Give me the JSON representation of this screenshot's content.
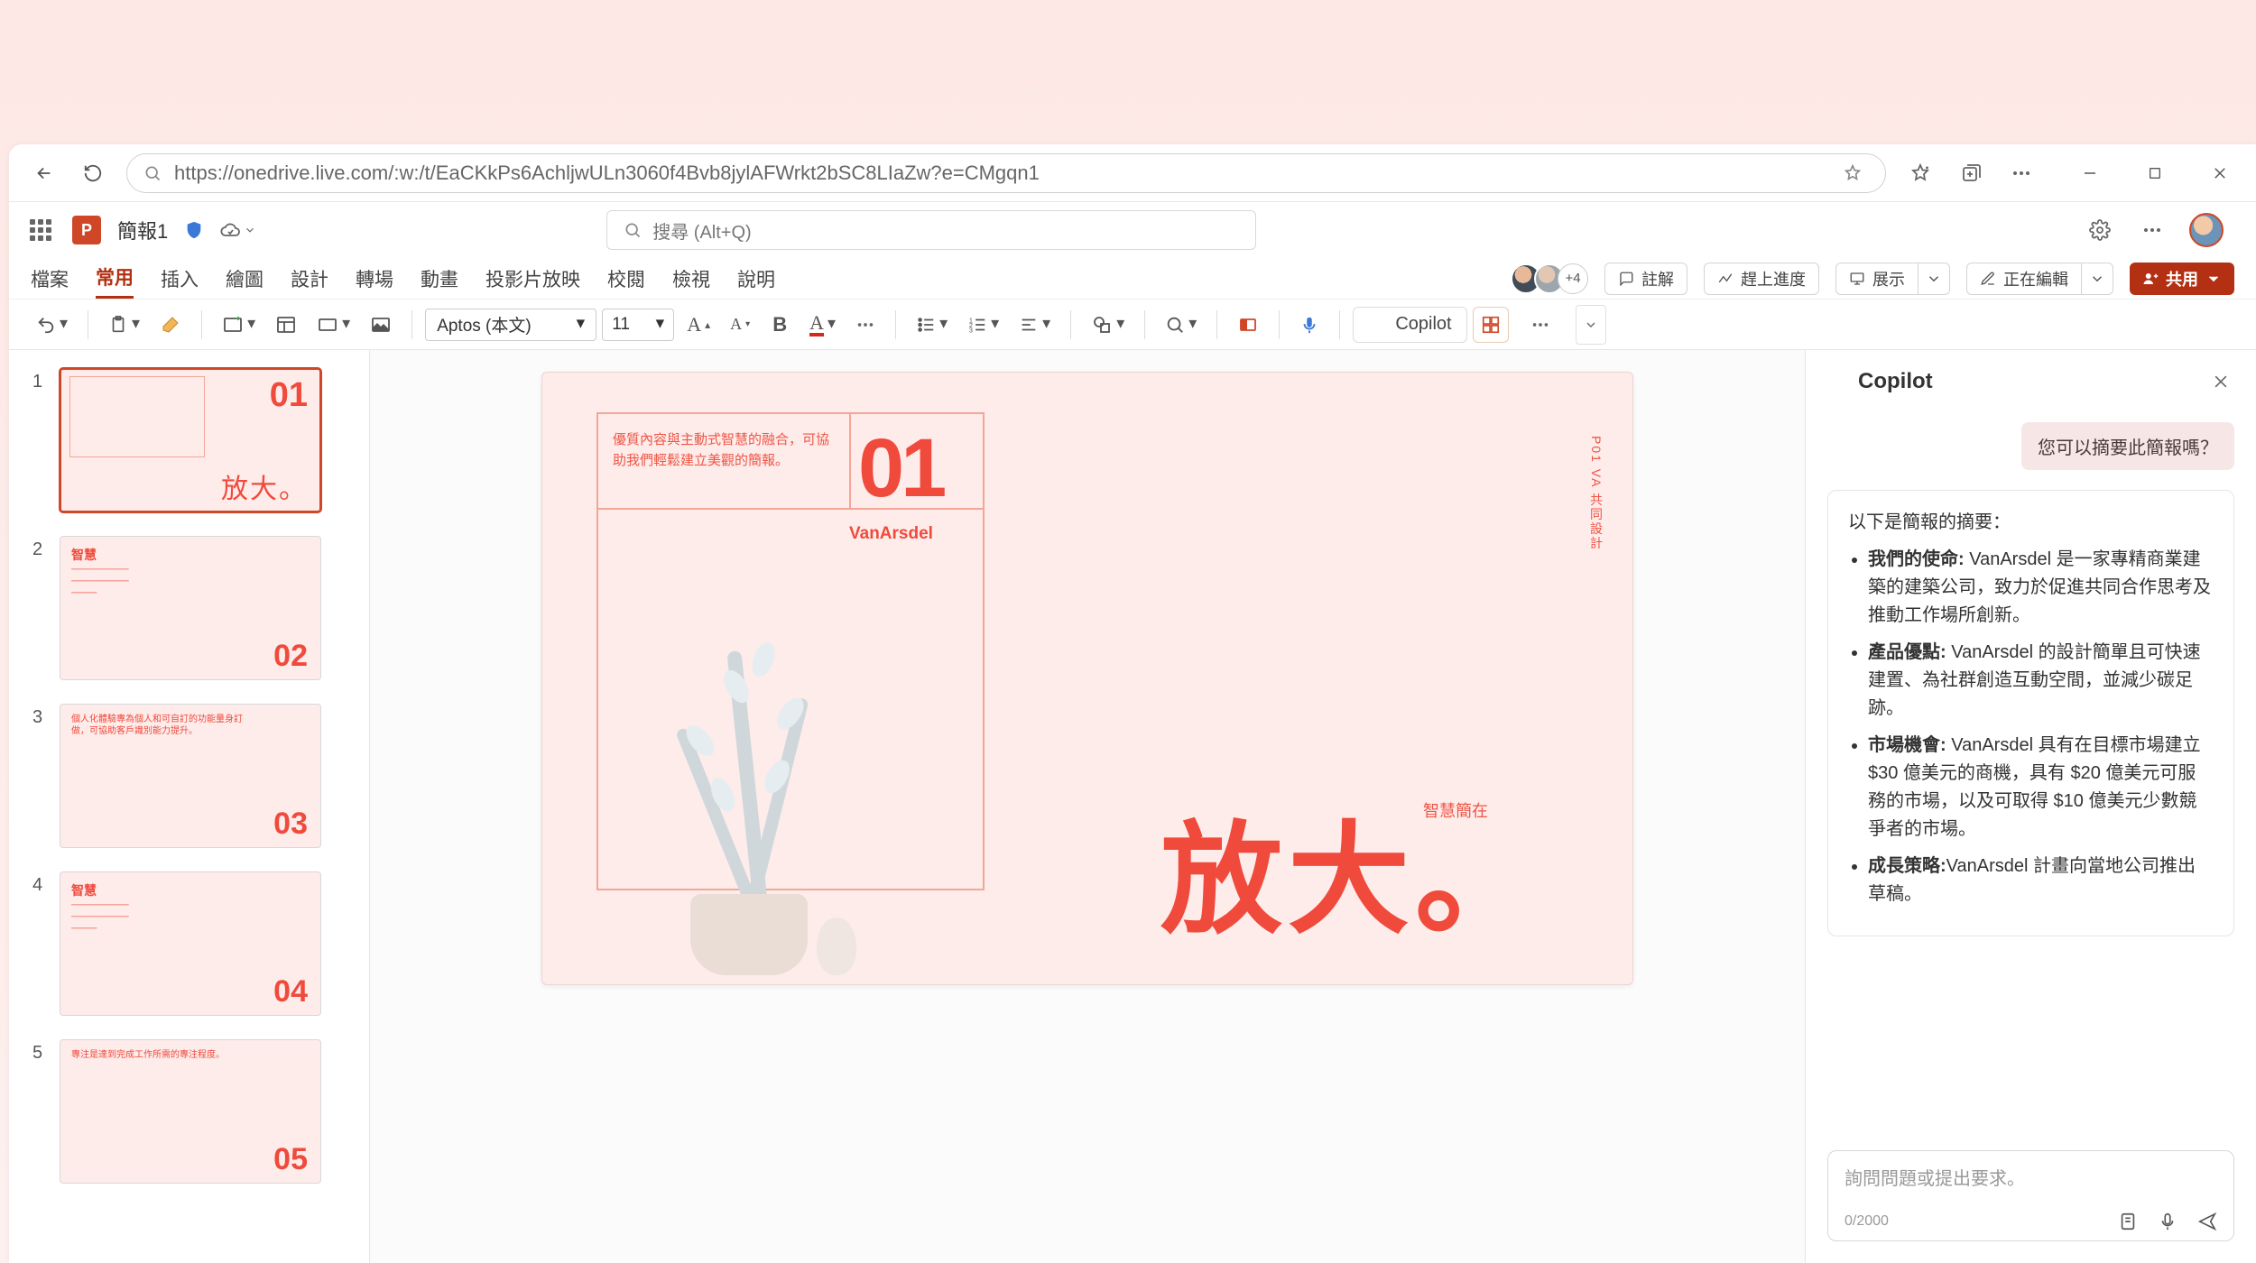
{
  "browser": {
    "url": "https://onedrive.live.com/:w:/t/EaCKkPs6AchljwULn3060f4Bvb8jylAFWrkt2bSC8LIaZw?e=CMgqn1"
  },
  "titlebar": {
    "doc_name": "簡報1",
    "search_placeholder": "搜尋 (Alt+Q)"
  },
  "tabs": {
    "file": "檔案",
    "home": "常用",
    "insert": "插入",
    "draw": "繪圖",
    "design": "設計",
    "transitions": "轉場",
    "animations": "動畫",
    "slideshow": "投影片放映",
    "review": "校閱",
    "view": "檢視",
    "help": "說明",
    "collab_extra": "+4",
    "comments": "註解",
    "catchup": "趕上進度",
    "present": "展示",
    "editing": "正在編輯",
    "share": "共用"
  },
  "toolbar": {
    "font_name": "Aptos (本文)",
    "font_size": "11",
    "copilot_label": "Copilot"
  },
  "slide": {
    "desc": "優質內容與主動式智慧的融合，可協助我們輕鬆建立美觀的簡報。",
    "bignum": "01",
    "brand": "VanArsdel",
    "supertitle": "智慧簡在",
    "mega": "放大。",
    "side": "P01   VA 共同設計"
  },
  "thumbs": [
    {
      "num": "1",
      "corner": "01",
      "big": "放大。"
    },
    {
      "num": "2",
      "head": "智慧",
      "corner": "02"
    },
    {
      "num": "3",
      "head": "個人化體驗專為個人和可自訂的功能量身訂做，可協助客戶識別能力提升。",
      "corner": "03"
    },
    {
      "num": "4",
      "head": "智慧",
      "corner": "04"
    },
    {
      "num": "5",
      "head": "專注是達到完成工作所需的專注程度。",
      "corner": "05"
    }
  ],
  "copilot": {
    "title": "Copilot",
    "user_msg": "您可以摘要此簡報嗎？",
    "ai_intro": "以下是簡報的摘要：",
    "bullets": [
      {
        "b": "我們的使命:",
        "t": " VanArsdel 是一家專精商業建築的建築公司，致力於促進共同合作思考及推動工作場所創新。"
      },
      {
        "b": "產品優點:",
        "t": " VanArsdel 的設計簡單且可快速建置、為社群創造互動空間，並減少碳足跡。"
      },
      {
        "b": "市場機會:",
        "t": " VanArsdel 具有在目標市場建立 $30 億美元的商機，具有 $20 億美元可服務的市場，以及可取得 $10 億美元少數競爭者的市場。"
      },
      {
        "b": "成長策略:",
        "t": "VanArsdel 計畫向當地公司推出草稿。"
      }
    ],
    "input_placeholder": "詢問問題或提出要求。",
    "counter": "0/2000"
  }
}
